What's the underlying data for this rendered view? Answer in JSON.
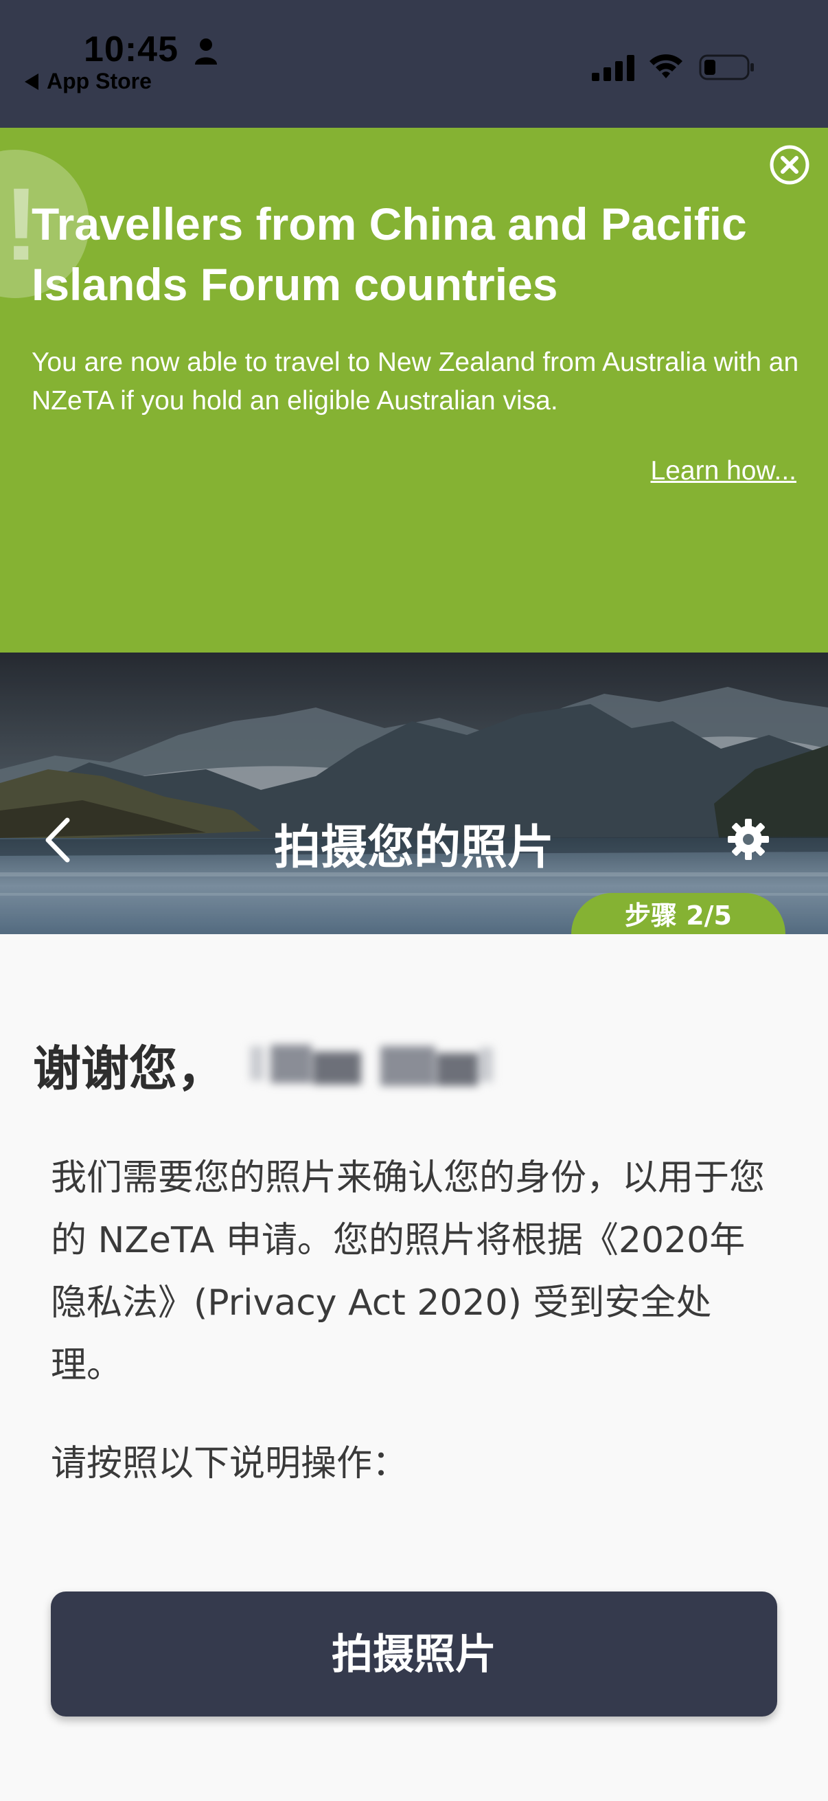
{
  "status_bar": {
    "time": "10:45",
    "back_app": "App Store"
  },
  "banner": {
    "title": "Travellers from China and Pacific Islands Forum countries",
    "text": "You are now able to travel to New Zealand from Australia with an NZeTA if you hold an eligible Australian visa.",
    "link": "Learn how...",
    "alert_glyph": "!",
    "color": "#85b233"
  },
  "header": {
    "title": "拍摄您的照片",
    "step": "步骤 2/5"
  },
  "content": {
    "greeting": "谢谢您，",
    "intro": "我们需要您的照片来确认您的身份，以用于您的 NZeTA 申请。您的照片将根据《2020年隐私法》(Privacy Act 2020) 受到安全处理。",
    "instructions": "请按照以下说明操作：",
    "button": "拍摄照片"
  },
  "colors": {
    "dark": "#353a4d",
    "green": "#85b233",
    "background": "#f9f9f9"
  },
  "icons": [
    "person-icon",
    "signal-icon",
    "wifi-icon",
    "battery-icon",
    "close-circle-icon",
    "alert-icon",
    "back-chevron-icon",
    "gear-icon"
  ]
}
